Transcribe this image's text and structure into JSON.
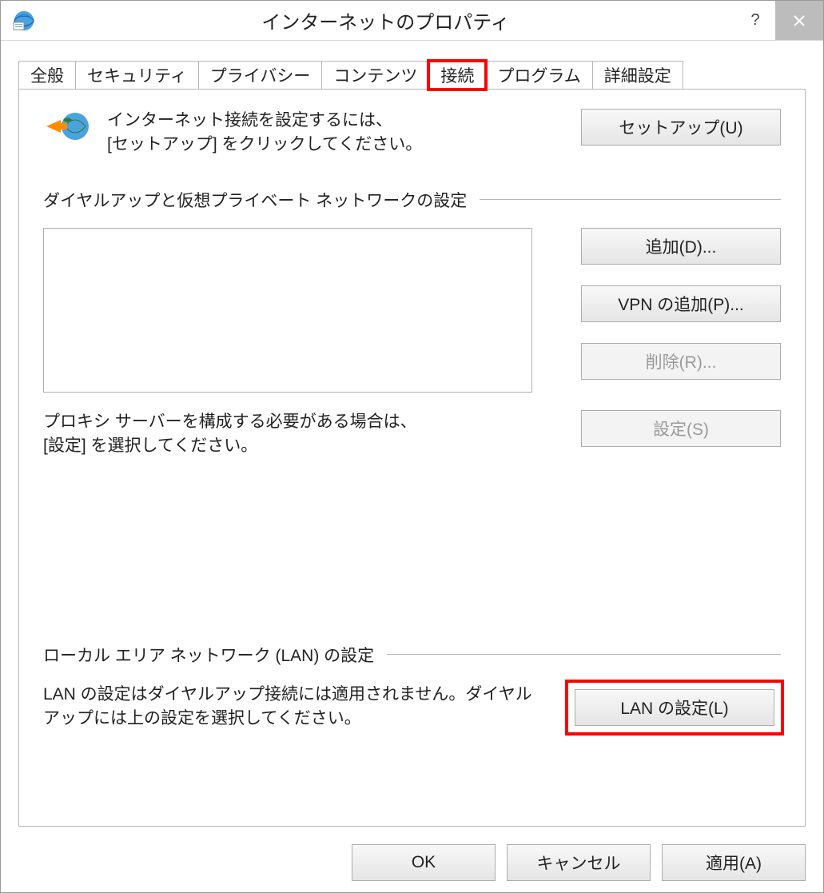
{
  "title": "インターネットのプロパティ",
  "tabs": {
    "general": "全般",
    "security": "セキュリティ",
    "privacy": "プライバシー",
    "content": "コンテンツ",
    "connections": "接続",
    "programs": "プログラム",
    "advanced": "詳細設定"
  },
  "setup": {
    "instruction_line1": "インターネット接続を設定するには、",
    "instruction_line2": "[セットアップ] をクリックしてください。",
    "button": "セットアップ(U)"
  },
  "dialup": {
    "section_label": "ダイヤルアップと仮想プライベート ネットワークの設定",
    "add": "追加(D)...",
    "add_vpn": "VPN の追加(P)...",
    "remove": "削除(R)...",
    "settings": "設定(S)"
  },
  "proxy": {
    "line1": "プロキシ サーバーを構成する必要がある場合は、",
    "line2": "[設定] を選択してください。"
  },
  "lan": {
    "section_label": "ローカル エリア ネットワーク (LAN) の設定",
    "note": "LAN の設定はダイヤルアップ接続には適用されません。ダイヤルアップには上の設定を選択してください。",
    "button": "LAN の設定(L)"
  },
  "footer": {
    "ok": "OK",
    "cancel": "キャンセル",
    "apply": "適用(A)"
  }
}
